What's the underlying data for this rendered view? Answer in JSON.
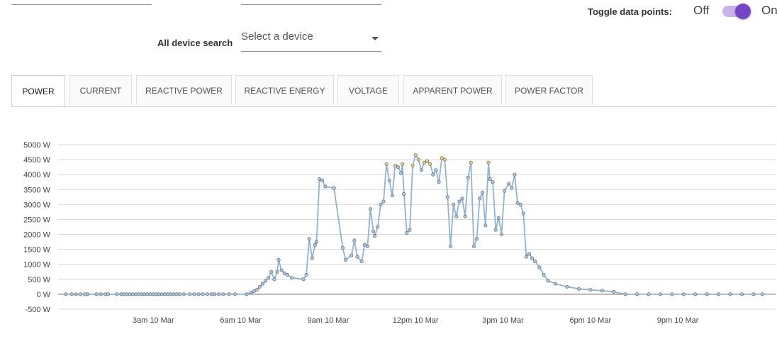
{
  "toggle": {
    "label": "Toggle data points:",
    "off": "Off",
    "on": "On",
    "state": "on",
    "accent": "#7445c8"
  },
  "search": {
    "label": "All device search",
    "placeholder": "Select a device"
  },
  "tabs": [
    {
      "label": "POWER",
      "active": true
    },
    {
      "label": "CURRENT",
      "active": false
    },
    {
      "label": "REACTIVE POWER",
      "active": false
    },
    {
      "label": "REACTIVE ENERGY",
      "active": false
    },
    {
      "label": "VOLTAGE",
      "active": false
    },
    {
      "label": "APPARENT POWER",
      "active": false
    },
    {
      "label": "POWER FACTOR",
      "active": false
    }
  ],
  "chart_data": {
    "type": "line",
    "title": "",
    "xlabel": "",
    "ylabel": "",
    "xlim": [
      0,
      24
    ],
    "ylim": [
      -500,
      5000
    ],
    "grid": true,
    "y_ticks": [
      -500,
      0,
      500,
      1000,
      1500,
      2000,
      2500,
      3000,
      3500,
      4000,
      4500,
      5000
    ],
    "y_tick_labels": [
      "-500 W",
      "0 W",
      "500 W",
      "1000 W",
      "1500 W",
      "2000 W",
      "2500 W",
      "3000 W",
      "3500 W",
      "4000 W",
      "4500 W",
      "5000 W"
    ],
    "x_ticks": [
      3,
      6,
      9,
      12,
      15,
      18,
      21
    ],
    "x_tick_labels": [
      "3am 10 Mar",
      "6am 10 Mar",
      "9am 10 Mar",
      "12pm 10 Mar",
      "3pm 10 Mar",
      "6pm 10 Mar",
      "9pm 10 Mar"
    ],
    "colors": {
      "line": "#8fb4d4",
      "marker": "#a9c8e6",
      "marker_edge": "#555555",
      "highlight": "#e8d27a",
      "grid": "#d9d9d9",
      "zero_line": "#888888"
    },
    "series": [
      {
        "values_x": [
          0.0,
          0.2,
          0.35,
          0.5,
          0.65,
          0.75,
          1.05,
          1.2,
          1.35,
          1.45,
          1.75,
          1.9,
          2.0,
          2.1,
          2.2,
          2.3,
          2.4,
          2.5,
          2.6,
          2.7,
          2.8,
          2.9,
          3.0,
          3.1,
          3.2,
          3.3,
          3.4,
          3.5,
          3.6,
          3.7,
          3.8,
          3.9,
          4.05,
          4.25,
          4.4,
          4.55,
          4.7,
          4.85,
          5.0,
          5.1,
          5.25,
          5.4,
          5.6,
          5.8,
          6.2,
          6.35,
          6.45,
          6.55,
          6.65,
          6.75,
          6.85,
          6.95,
          7.05,
          7.15,
          7.25,
          7.3,
          7.4,
          7.5,
          7.6,
          7.75,
          8.15,
          8.25,
          8.35,
          8.45,
          8.55,
          8.6,
          8.7,
          8.8,
          8.9,
          9.2,
          9.5,
          9.6,
          9.8,
          9.9,
          10.0,
          10.15,
          10.25,
          10.35,
          10.45,
          10.55,
          10.6,
          10.7,
          10.8,
          10.9,
          11.0,
          11.1,
          11.2,
          11.3,
          11.4,
          11.5,
          11.55,
          11.6,
          11.7,
          11.8,
          11.9,
          12.0,
          12.1,
          12.2,
          12.3,
          12.4,
          12.5,
          12.6,
          12.7,
          12.8,
          12.9,
          13.0,
          13.1,
          13.2,
          13.3,
          13.4,
          13.5,
          13.6,
          13.7,
          13.8,
          13.9,
          14.0,
          14.1,
          14.2,
          14.3,
          14.4,
          14.5,
          14.55,
          14.65,
          14.75,
          14.85,
          14.95,
          15.05,
          15.2,
          15.3,
          15.4,
          15.5,
          15.6,
          15.7,
          15.8,
          15.9,
          16.0,
          16.1,
          16.25,
          16.4,
          16.55,
          16.8,
          17.2,
          17.6,
          18.0,
          18.4,
          18.8,
          19.2,
          19.6,
          20.0,
          20.4,
          20.8,
          21.2,
          21.6,
          22.0,
          22.4,
          22.8,
          23.2,
          23.6,
          23.9
        ],
        "values_y": [
          0,
          0,
          0,
          0,
          0,
          0,
          0,
          0,
          0,
          0,
          0,
          0,
          0,
          0,
          0,
          0,
          0,
          0,
          0,
          0,
          0,
          0,
          0,
          0,
          0,
          0,
          0,
          0,
          0,
          0,
          0,
          0,
          0,
          0,
          0,
          0,
          0,
          0,
          0,
          0,
          0,
          0,
          0,
          0,
          0,
          50,
          100,
          150,
          250,
          350,
          450,
          550,
          750,
          500,
          750,
          1150,
          800,
          700,
          650,
          550,
          500,
          650,
          1850,
          1200,
          1650,
          1750,
          3850,
          3800,
          3600,
          3550,
          1550,
          1150,
          1300,
          1800,
          1250,
          1100,
          1650,
          1600,
          2850,
          2100,
          1950,
          2250,
          3000,
          3100,
          4350,
          3800,
          3300,
          4300,
          4250,
          4050,
          4350,
          3350,
          2050,
          2150,
          4300,
          4650,
          4500,
          4150,
          4400,
          4450,
          4350,
          4000,
          4150,
          3750,
          4550,
          4500,
          3250,
          1600,
          3000,
          2600,
          3100,
          3200,
          2600,
          3900,
          4400,
          1600,
          1850,
          3200,
          3400,
          2300,
          4400,
          3850,
          3750,
          2150,
          2550,
          2000,
          3450,
          3700,
          3550,
          4000,
          3050,
          3000,
          2700,
          1250,
          1350,
          1200,
          1100,
          900,
          650,
          450,
          350,
          250,
          180,
          150,
          120,
          80,
          0,
          0,
          0,
          0,
          0,
          0,
          0,
          0,
          0,
          0,
          0,
          0,
          0,
          0,
          0,
          0,
          0
        ]
      }
    ]
  }
}
